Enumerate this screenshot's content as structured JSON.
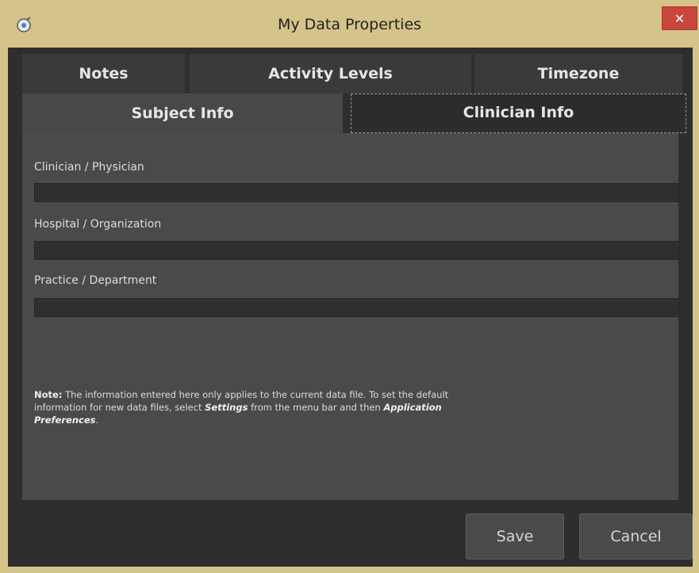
{
  "window": {
    "title": "My Data Properties",
    "close_glyph": "✕",
    "app_icon": "app-icon"
  },
  "tabs": {
    "row1": [
      {
        "label": "Notes"
      },
      {
        "label": "Activity Levels"
      },
      {
        "label": "Timezone"
      }
    ],
    "row2": [
      {
        "label": "Subject Info"
      },
      {
        "label": "Clinician Info",
        "active": true
      }
    ]
  },
  "form": {
    "fields": [
      {
        "label": "Clinician / Physician",
        "value": ""
      },
      {
        "label": "Hospital / Organization",
        "value": ""
      },
      {
        "label": "Practice / Department",
        "value": ""
      }
    ],
    "note": {
      "prefix": "Note:",
      "text1": " The information entered here only applies to the current data file. To set the default information for new data files, select ",
      "settings": "Settings",
      "text2": " from the menu bar and then ",
      "prefs": "Application Preferences",
      "text3": "."
    }
  },
  "buttons": {
    "save": "Save",
    "cancel": "Cancel"
  },
  "colors": {
    "titlebar": "#d4c48a",
    "close": "#c9463d",
    "background": "#2e2e2e",
    "panel": "#4a4a4a"
  }
}
